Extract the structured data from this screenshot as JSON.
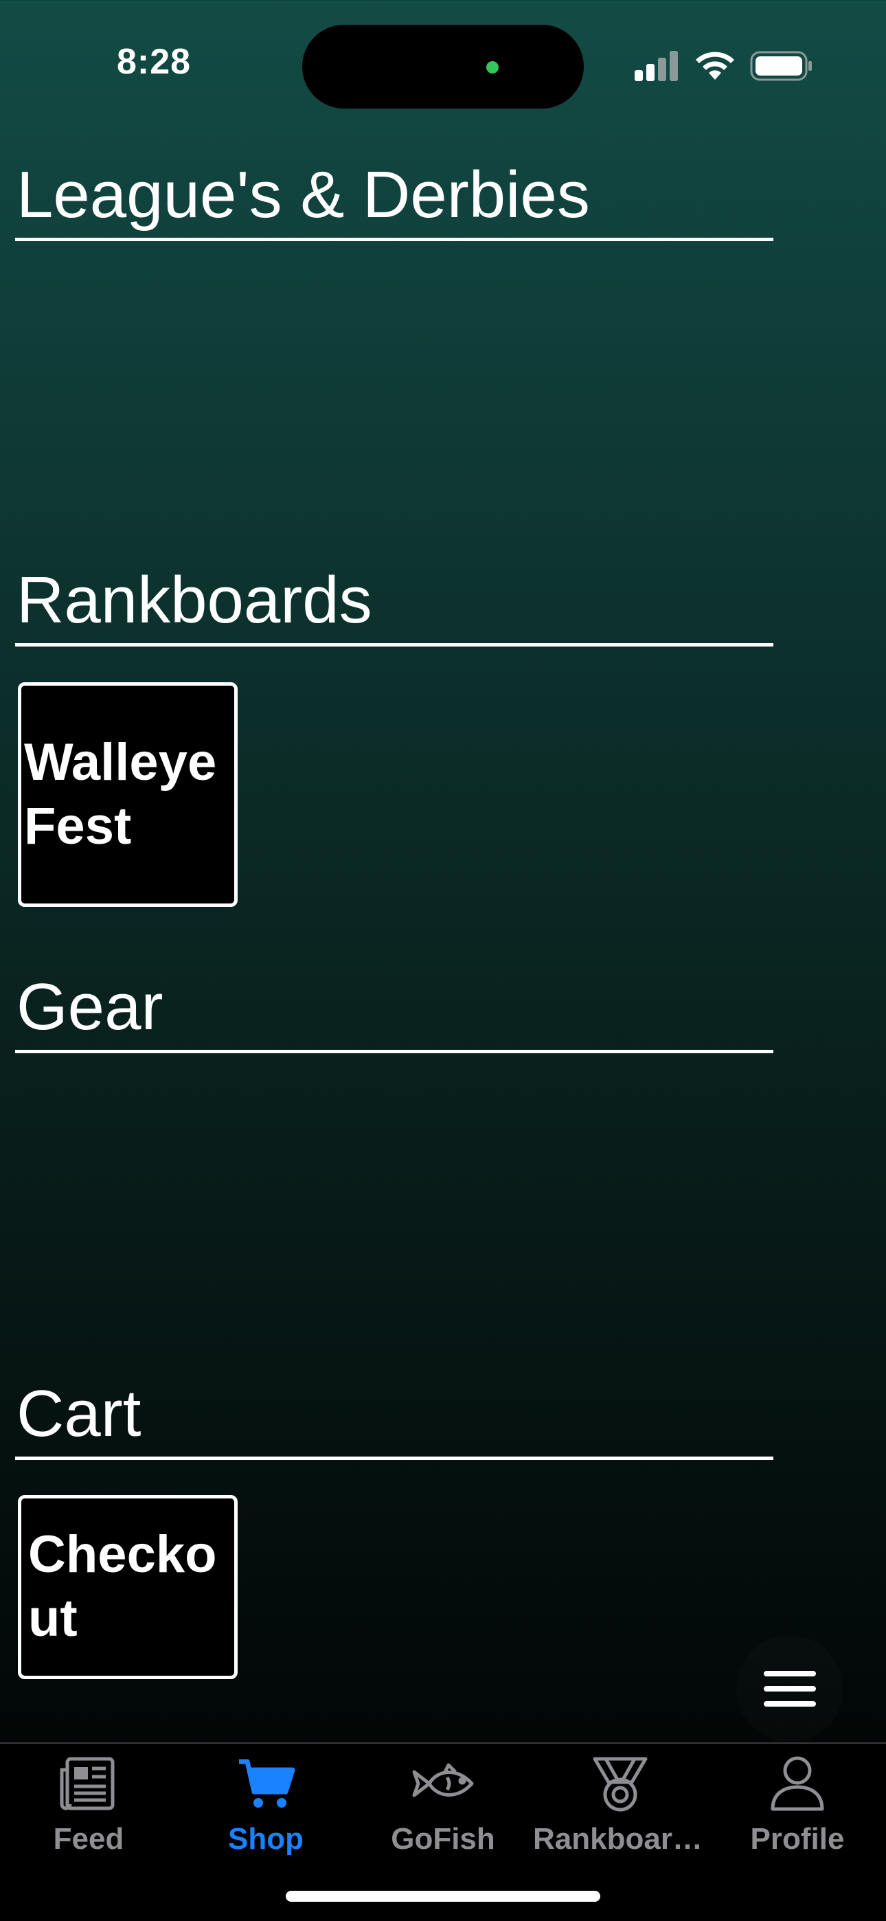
{
  "status_bar": {
    "time": "8:28"
  },
  "sections": [
    {
      "title": "League's & Derbies"
    },
    {
      "title": "Rankboards",
      "tile": "Walleye Fest"
    },
    {
      "title": "Gear"
    },
    {
      "title": "Cart",
      "tile": "Checkout"
    }
  ],
  "tab_bar": {
    "active_color": "#1a82ff",
    "inactive_color": "#8e8e93",
    "tabs": [
      {
        "label": "Feed",
        "icon": "newspaper-icon",
        "active": false
      },
      {
        "label": "Shop",
        "icon": "cart-icon",
        "active": true
      },
      {
        "label": "GoFish",
        "icon": "fish-icon",
        "active": false
      },
      {
        "label": "Rankboards",
        "icon": "medal-icon",
        "active": false
      },
      {
        "label": "Profile",
        "icon": "person-icon",
        "active": false
      }
    ]
  },
  "menu_button": {
    "icon": "hamburger-menu-icon"
  }
}
